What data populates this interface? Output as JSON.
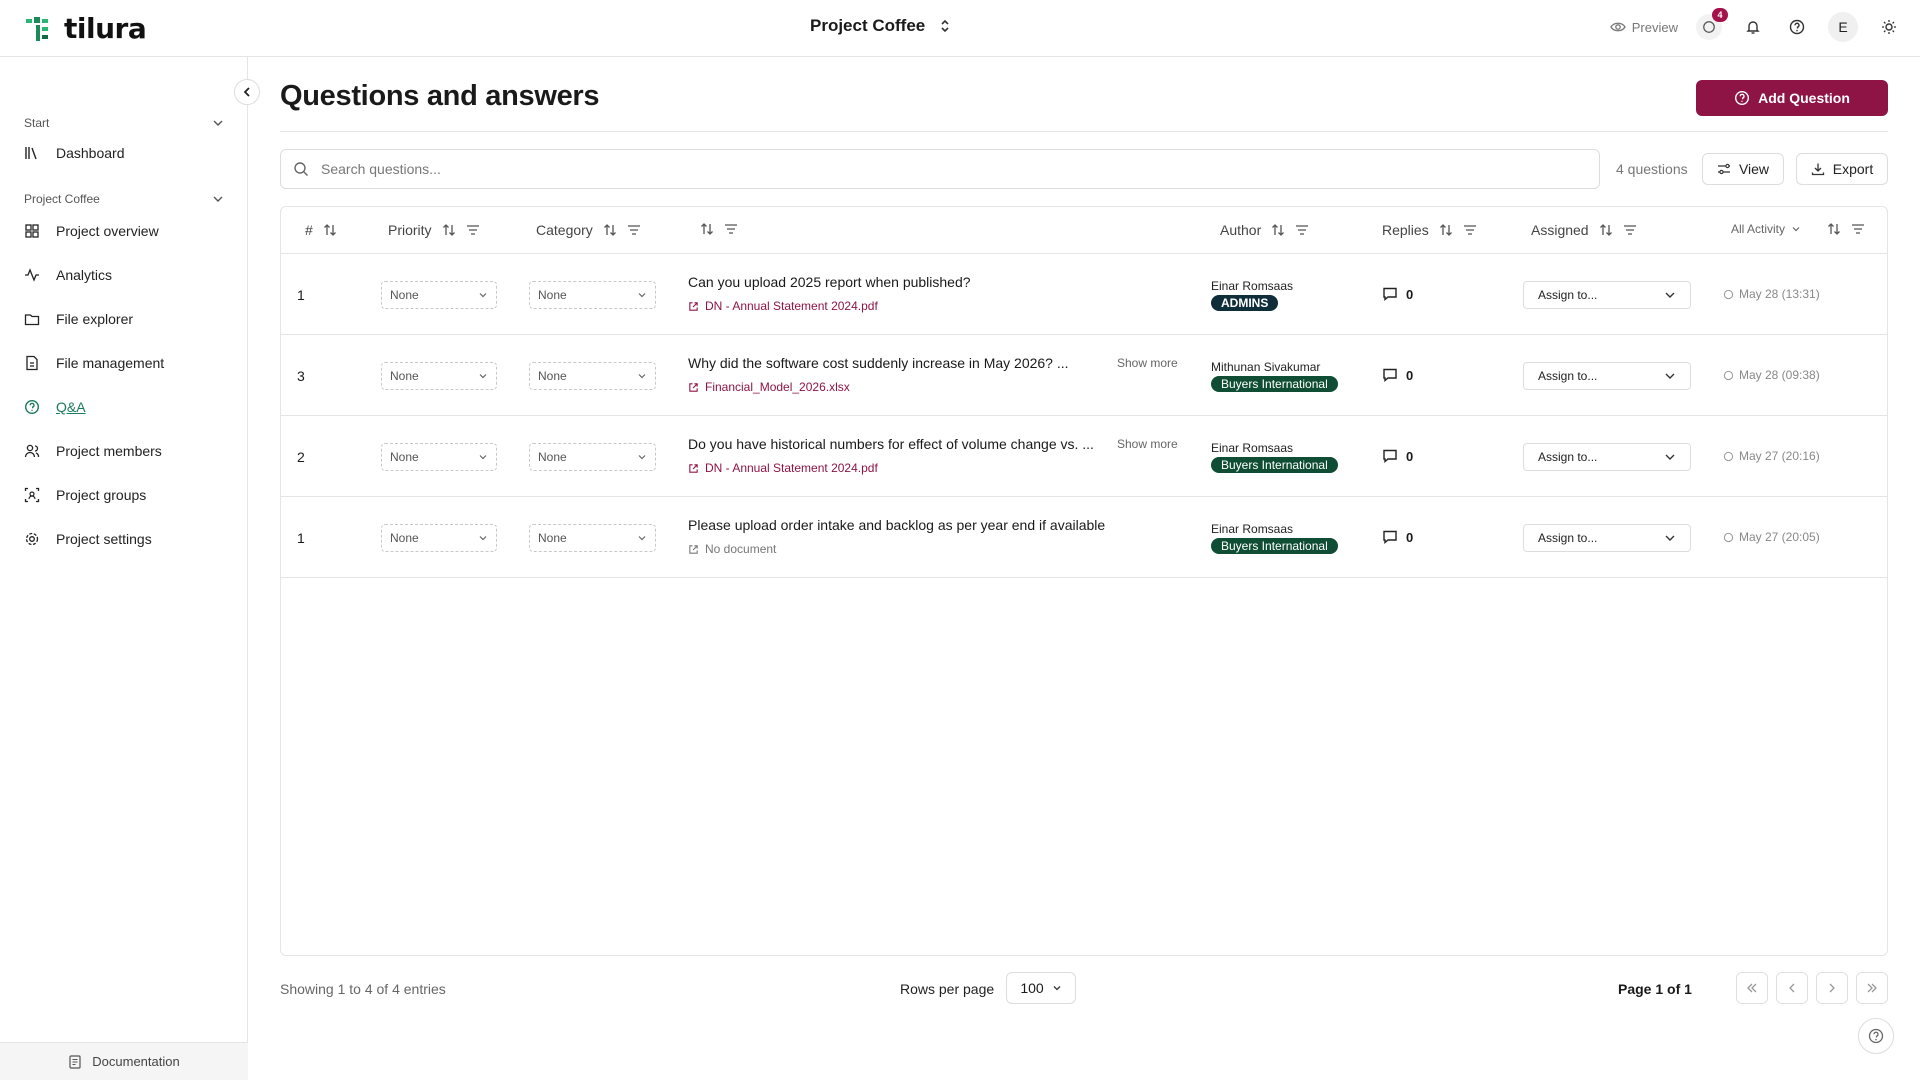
{
  "app": {
    "name": "tilura",
    "project": "Project Coffee"
  },
  "topbar": {
    "preview_label": "Preview",
    "qa_badge": "4",
    "avatar_initial": "E"
  },
  "sidebar": {
    "groups": [
      {
        "label": "Start",
        "items": [
          {
            "label": "Dashboard",
            "icon": "library-icon"
          }
        ]
      },
      {
        "label": "Project Coffee",
        "items": [
          {
            "label": "Project overview",
            "icon": "grid-icon"
          },
          {
            "label": "Analytics",
            "icon": "activity-icon"
          },
          {
            "label": "File explorer",
            "icon": "folder-icon"
          },
          {
            "label": "File management",
            "icon": "file-management-icon"
          },
          {
            "label": "Q&A",
            "icon": "chat-question-icon",
            "active": true
          },
          {
            "label": "Project members",
            "icon": "users-icon"
          },
          {
            "label": "Project groups",
            "icon": "group-icon"
          },
          {
            "label": "Project settings",
            "icon": "gear-icon"
          }
        ]
      }
    ],
    "footer_label": "Documentation"
  },
  "page": {
    "title": "Questions and answers",
    "add_button": "Add Question"
  },
  "toolbar": {
    "search_placeholder": "Search questions...",
    "count_label": "4 questions",
    "view_label": "View",
    "export_label": "Export"
  },
  "table": {
    "headers": {
      "num": "#",
      "priority": "Priority",
      "category": "Category",
      "author": "Author",
      "replies": "Replies",
      "assigned": "Assigned",
      "activity": "All Activity"
    },
    "rows": [
      {
        "num": "1",
        "priority": "None",
        "category": "None",
        "question": "Can you upload 2025 report when published?",
        "show_more": "",
        "document": "DN - Annual Statement 2024.pdf",
        "author": "Einar Romsaas",
        "group": "ADMINS",
        "replies": "0",
        "assign": "Assign to...",
        "activity": "May 28 (13:31)"
      },
      {
        "num": "3",
        "priority": "None",
        "category": "None",
        "question": "Why did the software cost suddenly increase in May 2026? ...",
        "show_more": "Show more",
        "document": "Financial_Model_2026.xlsx",
        "author": "Mithunan Sivakumar",
        "group": "Buyers International",
        "replies": "0",
        "assign": "Assign to...",
        "activity": "May 28 (09:38)"
      },
      {
        "num": "2",
        "priority": "None",
        "category": "None",
        "question": "Do you have historical numbers for effect of volume change vs. ...",
        "show_more": "Show more",
        "document": "DN - Annual Statement 2024.pdf",
        "author": "Einar Romsaas",
        "group": "Buyers International",
        "replies": "0",
        "assign": "Assign to...",
        "activity": "May 27 (20:16)"
      },
      {
        "num": "1",
        "priority": "None",
        "category": "None",
        "question": "Please upload order intake and backlog as per year end if available",
        "show_more": "",
        "document": "No document",
        "author": "Einar Romsaas",
        "group": "Buyers International",
        "replies": "0",
        "assign": "Assign to...",
        "activity": "May 27 (20:05)"
      }
    ]
  },
  "pagination": {
    "showing": "Showing 1 to 4 of 4 entries",
    "rows_label": "Rows per page",
    "rows_value": "100",
    "page_label": "Page 1 of 1"
  },
  "colors": {
    "brand": "#8e1446",
    "accent_green": "#1a7a5a",
    "tag_green": "#0f4d34"
  }
}
